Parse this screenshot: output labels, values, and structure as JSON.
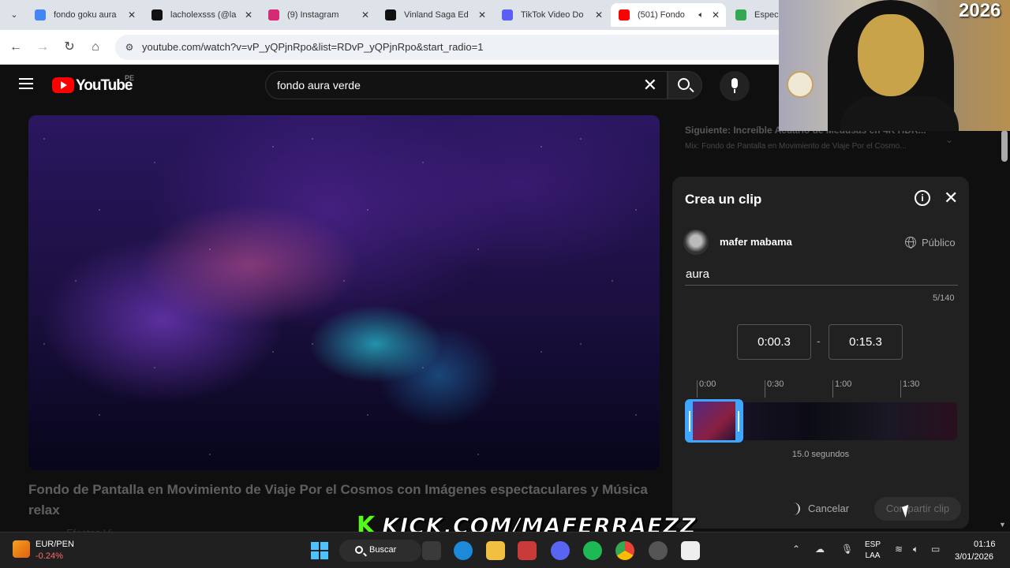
{
  "browser": {
    "tabs": [
      {
        "label": "fondo goku aura",
        "favicon_color": "#4285f4",
        "active": false
      },
      {
        "label": "lacholexsss (@la",
        "favicon_color": "#111111",
        "active": false
      },
      {
        "label": "(9) Instagram",
        "favicon_color": "#d62976",
        "active": false
      },
      {
        "label": "Vinland Saga Ed",
        "favicon_color": "#111111",
        "active": false
      },
      {
        "label": "TikTok Video Do",
        "favicon_color": "#5b5ef7",
        "active": false
      },
      {
        "label": "(501) Fondo",
        "favicon_color": "#ff0000",
        "active": true
      },
      {
        "label": "Espec",
        "favicon_color": "#34a853",
        "active": false
      }
    ],
    "url": "youtube.com/watch?v=vP_yQPjnRpo&list=RDvP_yQPjnRpo&start_radio=1"
  },
  "youtube": {
    "logo_text": "YouTube",
    "country": "PE",
    "search_value": "fondo aura  verde",
    "video_title": "Fondo de Pantalla en Movimiento de Viaje Por el Cosmos con Imágenes espectaculares y Música relax",
    "channel_hint": "Efectos Vi...",
    "up_next": {
      "title": "Siguiente: Increíble Acuario de Medusas en 4K HDR...",
      "subtitle": "Mix: Fondo de Pantalla en Movimiento de Viaje Por el Cosmo..."
    }
  },
  "clip_panel": {
    "title": "Crea un clip",
    "user_name": "mafer mabama",
    "privacy": "Público",
    "clip_name": "aura",
    "char_count": "5/140",
    "start_time": "0:00.3",
    "end_time": "0:15.3",
    "time_separator": "-",
    "ticks": [
      "0:00",
      "0:30",
      "1:00",
      "1:30"
    ],
    "duration_label": "15.0 segundos",
    "cancel_label": "Cancelar",
    "share_label": "Compartir clip",
    "accent_color": "#3ea6ff"
  },
  "overlay": {
    "year_badge": "2026",
    "kick_url": "KICK.COM/MAFERRAEZZ",
    "kick_logo": "K"
  },
  "taskbar": {
    "ticker_name": "EUR/PEN",
    "ticker_change": "-0.24%",
    "search_label": "Buscar",
    "language_line1": "ESP",
    "language_line2": "LAA",
    "time": "01:16",
    "date": "3/01/2026"
  }
}
